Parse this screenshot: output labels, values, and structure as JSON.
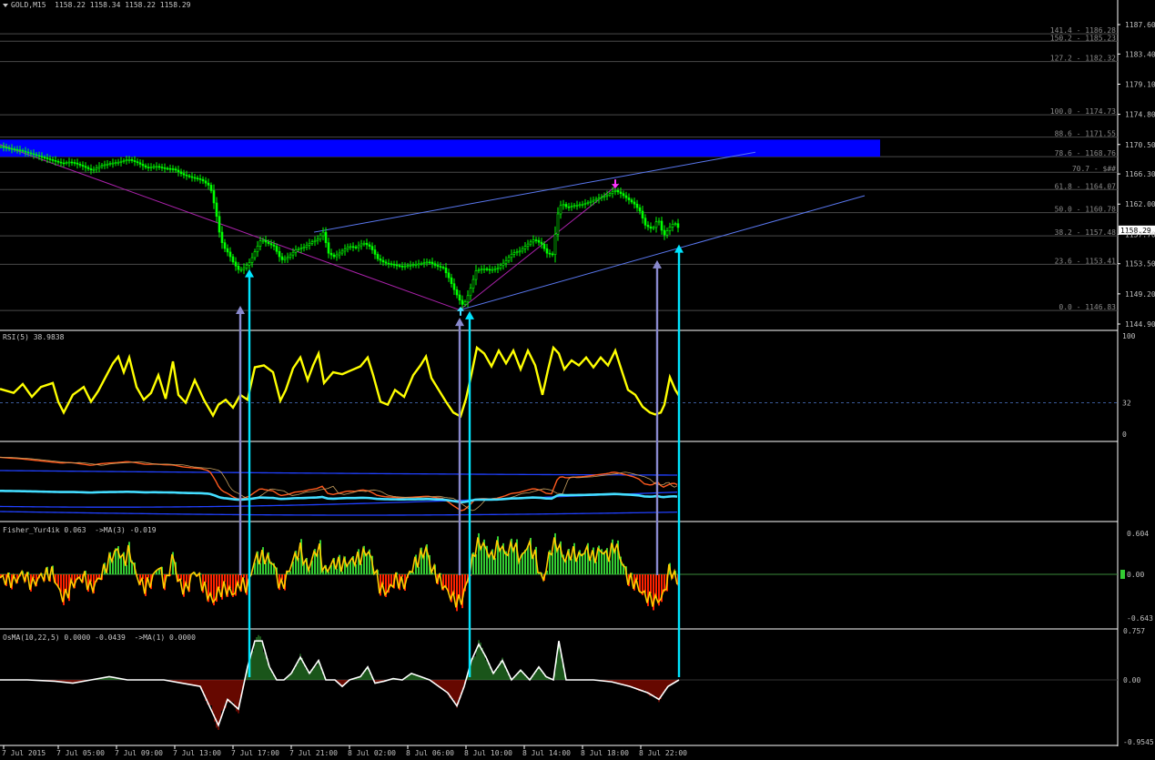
{
  "main_header": {
    "symbol": "GOLD,M15",
    "ohlc": "1158.22 1158.34 1158.22 1158.29"
  },
  "current_price": "1158.29",
  "colors": {
    "background": "#000000",
    "candle": "#00ff00",
    "fib_line": "#4a4a4a",
    "blue_zone": "#0000ff",
    "trendline": "#5a78f0",
    "pitchfork": "#aa22aa",
    "rsi": "#ffff00",
    "cyan_arrow": "#00e5ff",
    "gray_arrow": "#8888cc",
    "fisher_pos": "#33cc33",
    "fisher_neg": "#ff2200",
    "fisher_signal": "#ffcc00",
    "osma_line": "#ffffff"
  },
  "price_axis": [
    "1187.60",
    "1183.40",
    "1179.10",
    "1174.80",
    "1170.50",
    "1166.30",
    "1162.00",
    "1157.70",
    "1153.50",
    "1149.20",
    "1144.90"
  ],
  "fib_levels": [
    {
      "label": "141.4 - 1186.28",
      "value": 1186.28
    },
    {
      "label": "150.2 - 1185.23",
      "value": 1185.23
    },
    {
      "label": "127.2 - 1182.32",
      "value": 1182.32
    },
    {
      "label": "100.0 - 1174.73",
      "value": 1174.73
    },
    {
      "label": "88.6 - 1171.55",
      "value": 1171.55
    },
    {
      "label": "78.6 - 1168.76",
      "value": 1168.76
    },
    {
      "label": "70.7 - $##",
      "value": 1166.55
    },
    {
      "label": "61.8 - 1164.07",
      "value": 1164.07
    },
    {
      "label": "50.0 - 1160.78",
      "value": 1160.78
    },
    {
      "label": "38.2 - 1157.48",
      "value": 1157.48
    },
    {
      "label": "23.6 - 1153.41",
      "value": 1153.41
    },
    {
      "label": "0.0 - 1146.83",
      "value": 1146.83
    }
  ],
  "time_axis": [
    "7 Jul 2015",
    "7 Jul 05:00",
    "7 Jul 09:00",
    "7 Jul 13:00",
    "7 Jul 17:00",
    "7 Jul 21:00",
    "8 Jul 02:00",
    "8 Jul 06:00",
    "8 Jul 10:00",
    "8 Jul 14:00",
    "8 Jul 18:00",
    "8 Jul 22:00"
  ],
  "rsi": {
    "label": "RSI(5) 38.9838",
    "axis": [
      "100",
      "32",
      "0"
    ]
  },
  "fisher": {
    "label": "Fisher_Yur4ik 0.063  ->MA(3) -0.019",
    "axis": [
      "0.604",
      "0.00",
      "-0.643"
    ]
  },
  "osma": {
    "label": "OsMA(10,22,5) 0.0000 -0.0439  ->MA(1) 0.0000",
    "axis": [
      "0.757",
      "0.00",
      "-0.9545"
    ]
  },
  "chart_data": {
    "type": "candlestick",
    "symbol": "GOLD",
    "timeframe": "M15",
    "ylim": [
      1144.9,
      1187.6
    ],
    "close_path": [
      [
        0,
        1170.2
      ],
      [
        10,
        1169.9
      ],
      [
        20,
        1169.7
      ],
      [
        30,
        1169.3
      ],
      [
        40,
        1168.9
      ],
      [
        50,
        1168.5
      ],
      [
        60,
        1168.1
      ],
      [
        68,
        1167.8
      ],
      [
        75,
        1168.0
      ],
      [
        80,
        1167.9
      ],
      [
        90,
        1167.4
      ],
      [
        100,
        1166.8
      ],
      [
        110,
        1167.5
      ],
      [
        120,
        1167.8
      ],
      [
        130,
        1168.0
      ],
      [
        140,
        1168.4
      ],
      [
        150,
        1167.9
      ],
      [
        160,
        1167.2
      ],
      [
        170,
        1167.4
      ],
      [
        180,
        1167.1
      ],
      [
        190,
        1167.0
      ],
      [
        200,
        1166.2
      ],
      [
        210,
        1165.8
      ],
      [
        220,
        1165.5
      ],
      [
        230,
        1164.5
      ],
      [
        236,
        1161.0
      ],
      [
        240,
        1158.0
      ],
      [
        244,
        1156.0
      ],
      [
        250,
        1155.0
      ],
      [
        256,
        1153.5
      ],
      [
        262,
        1152.5
      ],
      [
        268,
        1153.0
      ],
      [
        274,
        1153.8
      ],
      [
        280,
        1155.5
      ],
      [
        286,
        1157.0
      ],
      [
        292,
        1156.5
      ],
      [
        300,
        1156.0
      ],
      [
        308,
        1154.0
      ],
      [
        316,
        1154.5
      ],
      [
        324,
        1155.5
      ],
      [
        332,
        1155.8
      ],
      [
        340,
        1156.5
      ],
      [
        348,
        1157.0
      ],
      [
        354,
        1158.0
      ],
      [
        360,
        1155.0
      ],
      [
        366,
        1154.5
      ],
      [
        374,
        1155.2
      ],
      [
        382,
        1156.0
      ],
      [
        390,
        1155.8
      ],
      [
        398,
        1156.5
      ],
      [
        406,
        1155.9
      ],
      [
        414,
        1154.2
      ],
      [
        422,
        1153.6
      ],
      [
        430,
        1153.4
      ],
      [
        440,
        1153.1
      ],
      [
        450,
        1153.3
      ],
      [
        460,
        1153.5
      ],
      [
        470,
        1153.8
      ],
      [
        478,
        1153.2
      ],
      [
        486,
        1152.9
      ],
      [
        492,
        1151.5
      ],
      [
        498,
        1149.8
      ],
      [
        504,
        1148.3
      ],
      [
        508,
        1147.5
      ],
      [
        512,
        1148.6
      ],
      [
        516,
        1150.0
      ],
      [
        522,
        1152.5
      ],
      [
        530,
        1152.8
      ],
      [
        538,
        1152.6
      ],
      [
        546,
        1152.9
      ],
      [
        554,
        1153.8
      ],
      [
        562,
        1155.0
      ],
      [
        570,
        1155.3
      ],
      [
        578,
        1156.2
      ],
      [
        586,
        1157.0
      ],
      [
        594,
        1156.3
      ],
      [
        600,
        1155.0
      ],
      [
        606,
        1154.8
      ],
      [
        612,
        1160.6
      ],
      [
        616,
        1162.2
      ],
      [
        622,
        1161.5
      ],
      [
        630,
        1161.8
      ],
      [
        640,
        1162.0
      ],
      [
        650,
        1162.5
      ],
      [
        660,
        1163.0
      ],
      [
        668,
        1163.4
      ],
      [
        674,
        1164.0
      ],
      [
        680,
        1163.6
      ],
      [
        688,
        1162.8
      ],
      [
        696,
        1162.0
      ],
      [
        702,
        1161.0
      ],
      [
        708,
        1159.0
      ],
      [
        716,
        1158.4
      ],
      [
        722,
        1160.0
      ],
      [
        728,
        1157.4
      ],
      [
        734,
        1158.6
      ],
      [
        740,
        1159.4
      ],
      [
        746,
        1158.29
      ]
    ],
    "trendlines": [
      {
        "name": "upper_channel",
        "from": [
          345,
          1158.0
        ],
        "to": [
          830,
          1169.4
        ]
      },
      {
        "name": "lower_channel",
        "from": [
          505,
          1146.9
        ],
        "to": [
          950,
          1163.2
        ]
      },
      {
        "name": "pitchfork_down",
        "from": [
          0,
          1170.5
        ],
        "to": [
          505,
          1146.9
        ]
      },
      {
        "name": "pitchfork_up",
        "from": [
          505,
          1146.9
        ],
        "to": [
          680,
          1164.9
        ]
      }
    ],
    "blue_zone": {
      "x_from": 0,
      "x_to": 967,
      "y_from": 1168.76,
      "y_to": 1171.2
    },
    "arrows": {
      "cyan": [
        {
          "x": 274,
          "bottom_pane": "osma"
        },
        {
          "x": 516,
          "bottom_pane": "osma"
        },
        {
          "x": 746,
          "bottom_pane": "osma"
        }
      ],
      "gray": [
        {
          "x": 264,
          "top": 1147.5
        },
        {
          "x": 505,
          "top": 1145.8
        },
        {
          "x": 722,
          "top": 1154.0
        }
      ]
    },
    "markers": [
      {
        "type": "up_arrow",
        "x": 506,
        "price": 1146.6
      },
      {
        "type": "down_arrow",
        "x": 676,
        "price": 1165.0
      }
    ],
    "rsi_path": [
      [
        0,
        46
      ],
      [
        15,
        42
      ],
      [
        25,
        51
      ],
      [
        35,
        38
      ],
      [
        45,
        48
      ],
      [
        58,
        52
      ],
      [
        64,
        33
      ],
      [
        70,
        22
      ],
      [
        80,
        40
      ],
      [
        92,
        48
      ],
      [
        100,
        33
      ],
      [
        108,
        44
      ],
      [
        116,
        58
      ],
      [
        124,
        72
      ],
      [
        130,
        79
      ],
      [
        136,
        63
      ],
      [
        142,
        78
      ],
      [
        150,
        48
      ],
      [
        158,
        35
      ],
      [
        166,
        42
      ],
      [
        174,
        60
      ],
      [
        182,
        36
      ],
      [
        190,
        74
      ],
      [
        196,
        40
      ],
      [
        204,
        32
      ],
      [
        214,
        55
      ],
      [
        224,
        35
      ],
      [
        234,
        19
      ],
      [
        240,
        30
      ],
      [
        248,
        35
      ],
      [
        256,
        27
      ],
      [
        264,
        40
      ],
      [
        272,
        35
      ],
      [
        280,
        68
      ],
      [
        290,
        70
      ],
      [
        300,
        63
      ],
      [
        308,
        34
      ],
      [
        314,
        45
      ],
      [
        322,
        67
      ],
      [
        330,
        78
      ],
      [
        338,
        55
      ],
      [
        344,
        70
      ],
      [
        350,
        82
      ],
      [
        356,
        52
      ],
      [
        366,
        63
      ],
      [
        376,
        61
      ],
      [
        386,
        65
      ],
      [
        396,
        69
      ],
      [
        404,
        78
      ],
      [
        410,
        60
      ],
      [
        418,
        33
      ],
      [
        426,
        30
      ],
      [
        434,
        45
      ],
      [
        444,
        38
      ],
      [
        454,
        60
      ],
      [
        462,
        70
      ],
      [
        468,
        79
      ],
      [
        474,
        57
      ],
      [
        482,
        45
      ],
      [
        490,
        33
      ],
      [
        498,
        22
      ],
      [
        506,
        18
      ],
      [
        512,
        36
      ],
      [
        518,
        61
      ],
      [
        524,
        88
      ],
      [
        532,
        82
      ],
      [
        540,
        69
      ],
      [
        548,
        85
      ],
      [
        556,
        72
      ],
      [
        564,
        85
      ],
      [
        572,
        66
      ],
      [
        580,
        85
      ],
      [
        588,
        70
      ],
      [
        596,
        40
      ],
      [
        602,
        65
      ],
      [
        608,
        88
      ],
      [
        614,
        82
      ],
      [
        620,
        66
      ],
      [
        628,
        75
      ],
      [
        636,
        70
      ],
      [
        644,
        78
      ],
      [
        652,
        68
      ],
      [
        660,
        78
      ],
      [
        668,
        70
      ],
      [
        676,
        85
      ],
      [
        684,
        62
      ],
      [
        690,
        45
      ],
      [
        698,
        40
      ],
      [
        706,
        28
      ],
      [
        714,
        22
      ],
      [
        720,
        20
      ],
      [
        726,
        22
      ],
      [
        730,
        30
      ],
      [
        736,
        58
      ],
      [
        742,
        45
      ],
      [
        746,
        38.98
      ]
    ],
    "osma_signal_path": [
      [
        0,
        0
      ],
      [
        30,
        0
      ],
      [
        60,
        -0.02
      ],
      [
        80,
        -0.05
      ],
      [
        100,
        0
      ],
      [
        120,
        0.05
      ],
      [
        140,
        0
      ],
      [
        180,
        0
      ],
      [
        200,
        -0.05
      ],
      [
        220,
        -0.1
      ],
      [
        230,
        -0.4
      ],
      [
        240,
        -0.7
      ],
      [
        250,
        -0.3
      ],
      [
        262,
        -0.45
      ],
      [
        272,
        0.2
      ],
      [
        280,
        0.6
      ],
      [
        288,
        0.6
      ],
      [
        296,
        0.2
      ],
      [
        304,
        0
      ],
      [
        312,
        0
      ],
      [
        320,
        0.1
      ],
      [
        330,
        0.35
      ],
      [
        340,
        0.1
      ],
      [
        350,
        0.3
      ],
      [
        358,
        0
      ],
      [
        368,
        0
      ],
      [
        376,
        -0.1
      ],
      [
        384,
        0
      ],
      [
        396,
        0.05
      ],
      [
        404,
        0.2
      ],
      [
        412,
        -0.05
      ],
      [
        422,
        -0.02
      ],
      [
        432,
        0.02
      ],
      [
        442,
        0
      ],
      [
        452,
        0.1
      ],
      [
        462,
        0.05
      ],
      [
        472,
        0
      ],
      [
        482,
        -0.1
      ],
      [
        492,
        -0.2
      ],
      [
        502,
        -0.4
      ],
      [
        510,
        -0.1
      ],
      [
        518,
        0.3
      ],
      [
        526,
        0.55
      ],
      [
        534,
        0.35
      ],
      [
        542,
        0.1
      ],
      [
        552,
        0.3
      ],
      [
        562,
        0
      ],
      [
        572,
        0.15
      ],
      [
        582,
        0
      ],
      [
        592,
        0.2
      ],
      [
        600,
        0.05
      ],
      [
        608,
        0
      ],
      [
        614,
        0.6
      ],
      [
        622,
        0
      ],
      [
        632,
        0
      ],
      [
        652,
        0
      ],
      [
        672,
        -0.03
      ],
      [
        692,
        -0.1
      ],
      [
        712,
        -0.2
      ],
      [
        724,
        -0.3
      ],
      [
        734,
        -0.1
      ],
      [
        746,
        0
      ]
    ]
  }
}
